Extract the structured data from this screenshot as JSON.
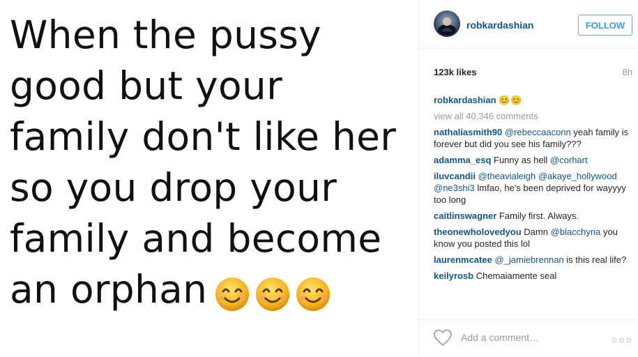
{
  "post": {
    "image_lines": [
      "When the pussy",
      "good but your",
      "family don't like her",
      "so you drop your",
      "family and become",
      "an orphan"
    ],
    "image_emoji": [
      "smiling-face",
      "smiling-face",
      "smiling-face"
    ]
  },
  "header": {
    "username": "robkardashian",
    "follow_label": "FOLLOW"
  },
  "stats": {
    "likes": "123k likes",
    "time": "8h"
  },
  "caption": {
    "username": "robkardashian",
    "text": "😊😊"
  },
  "view_all": "view all 40,346 comments",
  "comments": [
    {
      "user": "nathaliasmith90",
      "mention": "@rebeccaaconn",
      "text": " yeah family is forever but did you see his family???"
    },
    {
      "user": "adamma_esq",
      "pre": " Funny as hell ",
      "mention": "@corhart"
    },
    {
      "user": "iluvcandii",
      "mention": "@theavialeigh",
      "mention2": "@akaye_hollywood",
      "mention3": "@ne3shi3",
      "text": " lmfao, he's been deprived for wayyyy too long"
    },
    {
      "user": "caitlinswagner",
      "text": " Family first. Always."
    },
    {
      "user": "theonewholovedyou",
      "pre": " Damn ",
      "mention": "@blacchyna",
      "text": " you know you posted this lol"
    },
    {
      "user": "laurenmcatee",
      "mention": "@_jamiebrennan",
      "text": " is this real life?"
    },
    {
      "user": "keilyrosb",
      "text": " Chemaiamente seal"
    }
  ],
  "footer": {
    "add_comment_placeholder": "Add a comment…",
    "more_label": "○○○"
  },
  "colors": {
    "link": "#125688",
    "follow": "#3897f0",
    "muted": "#999999"
  },
  "icons": [
    "avatar",
    "heart-icon",
    "more-options-icon",
    "smiling-face-emoji"
  ]
}
